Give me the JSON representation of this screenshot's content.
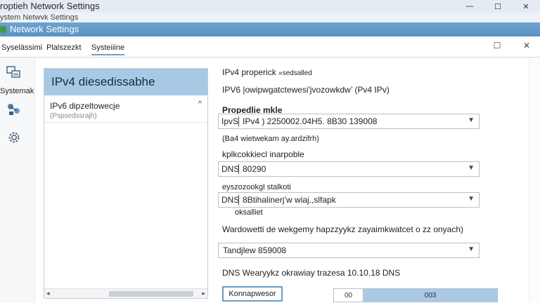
{
  "window": {
    "outer_title": "Ustawienia Network Settings",
    "outer_title_visible": "roptieh Network Settings",
    "controls": {
      "minimize": "—",
      "maximize": "☐",
      "close": "✕"
    },
    "sub_title": "ystem Netwvk Settings"
  },
  "header": {
    "title": "Network Settings"
  },
  "tabs": [
    {
      "label": "Syselässimi"
    },
    {
      "label": "Plalszezkt"
    },
    {
      "label": "Systeiiine"
    }
  ],
  "row_controls": {
    "maximize": "☐",
    "close": "✕"
  },
  "sidebar": {
    "label": "Systemak",
    "icons": [
      "network-icon",
      "nodes-icon",
      "gear-icon"
    ]
  },
  "list": {
    "header": "IPv4 diesedissabhe",
    "item_title": "IPv6 dipzeltowecje",
    "item_sub": "(Pspsedssrajh)",
    "caret": "^"
  },
  "form": {
    "line1": "IPv4 properick",
    "line1_suffix": "»sedsalled",
    "line2": "IPV6 |owipwgatctewesi'jvozowkdw’ (Pv4 IPv)",
    "section_title": "Propedlie mkle",
    "ipv_dropdown": {
      "prefix": "IpvS",
      "value": "IPv4 ) 2250002.04H5. 8B30 139008"
    },
    "ipv_note": "(Ba4 wietwekam ay.ardzifrh)",
    "kplk_label": "kplkcokkiecl inarpoble",
    "dns_dropdown": {
      "prefix": "DNS",
      "value": "80290"
    },
    "eysz_label": "eyszozookgl stalkoti",
    "dns_dropdown2": {
      "prefix": "DNS",
      "value": "8Btihalinerj’w wiaj.,slfapk"
    },
    "oksalliet": "oksalliet",
    "warning": "Wardowetti de wekgemy hapzzyykz zayaimkwatcet o zz onyach)",
    "tandjlew_dropdown": {
      "value": "Tandjlew 859008"
    },
    "dns_note": "DNS Wearyykz okrawiay trazesa 10.10.18 DNS"
  },
  "buttons": {
    "left": "Konnapwesor",
    "group_left": "00",
    "group_right": "003"
  },
  "colors": {
    "blue_band": "#5a92c4",
    "list_header": "#a8c9e6",
    "accent": "#6a9dc9"
  }
}
